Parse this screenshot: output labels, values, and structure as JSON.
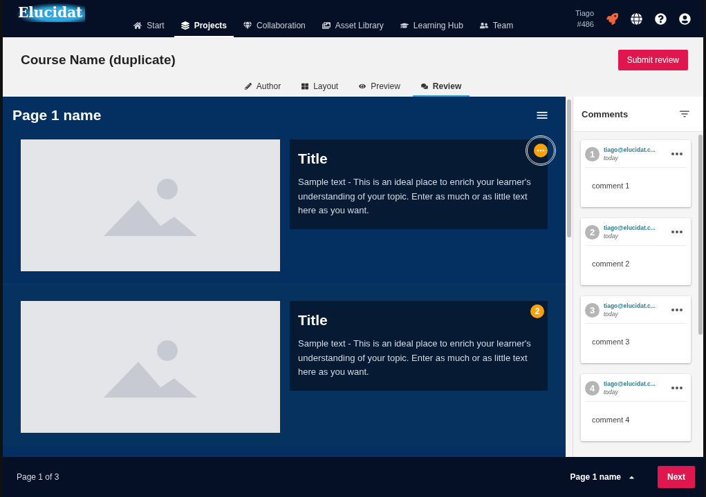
{
  "brand": {
    "logo": "Elucidat"
  },
  "nav": [
    {
      "label": "Start",
      "selected": false
    },
    {
      "label": "Projects",
      "selected": true
    },
    {
      "label": "Collaboration",
      "selected": false
    },
    {
      "label": "Asset Library",
      "selected": false
    },
    {
      "label": "Learning Hub",
      "selected": false
    },
    {
      "label": "Team",
      "selected": false
    }
  ],
  "user": {
    "name": "Tiago",
    "id": "#486"
  },
  "course": {
    "title": "Course Name (duplicate)",
    "submit": "Submit review"
  },
  "modes": [
    {
      "label": "Author",
      "selected": false
    },
    {
      "label": "Layout",
      "selected": false
    },
    {
      "label": "Preview",
      "selected": false
    },
    {
      "label": "Review",
      "selected": true
    }
  ],
  "page": {
    "title": "Page 1 name",
    "blocks": [
      {
        "title": "Title",
        "text": "Sample text - This is an ideal place to enrich your learner's understanding of your topic. Enter as much or as little text here as you want.",
        "marker": {
          "kind": "menu",
          "hovered": true
        }
      },
      {
        "title": "Title",
        "text": "Sample text - This is an ideal place to enrich your learner's understanding of your topic. Enter as much or as little text here as you want.",
        "marker": {
          "kind": "number",
          "label": "2",
          "hovered": false
        }
      }
    ]
  },
  "comments": {
    "title": "Comments",
    "items": [
      {
        "number": "1",
        "author": "tiago@elucidat.c...",
        "time": "today",
        "text": "comment 1"
      },
      {
        "number": "2",
        "author": "tiago@elucidat.c...",
        "time": "today",
        "text": "comment 2"
      },
      {
        "number": "3",
        "author": "tiago@elucidat.c...",
        "time": "today",
        "text": "comment 3"
      },
      {
        "number": "4",
        "author": "tiago@elucidat.c...",
        "time": "today",
        "text": "comment 4"
      }
    ]
  },
  "footer": {
    "pager": "Page 1 of 3",
    "page_select": "Page 1 name",
    "next": "Next"
  }
}
